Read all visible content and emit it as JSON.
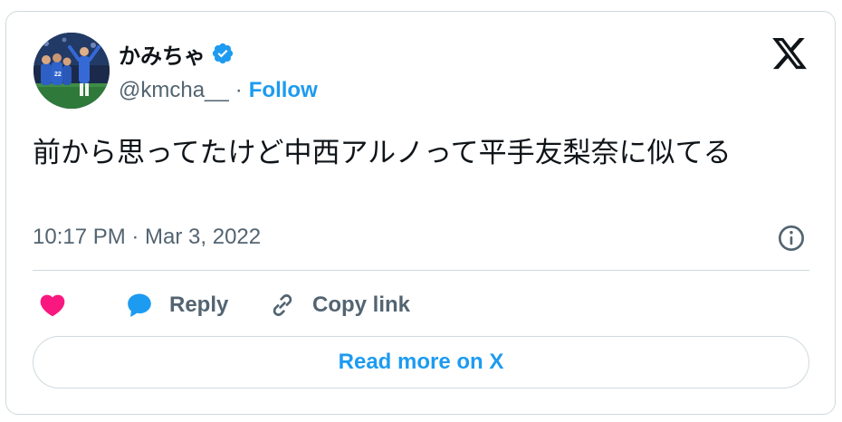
{
  "author": {
    "name": "かみちゃ",
    "handle": "@kmcha__",
    "separator": "·",
    "follow_label": "Follow",
    "verified": true
  },
  "tweet": {
    "text": "前から思ってたけど中西アルノって平手友梨奈に似てる",
    "timestamp": "10:17 PM · Mar 3, 2022"
  },
  "actions": {
    "like_icon": "heart-icon",
    "reply_label": "Reply",
    "copy_link_label": "Copy link"
  },
  "read_more_label": "Read more on X",
  "colors": {
    "accent": "#1d9bf0",
    "like": "#f91880",
    "secondary_text": "#536471",
    "border": "#cfd9de"
  }
}
